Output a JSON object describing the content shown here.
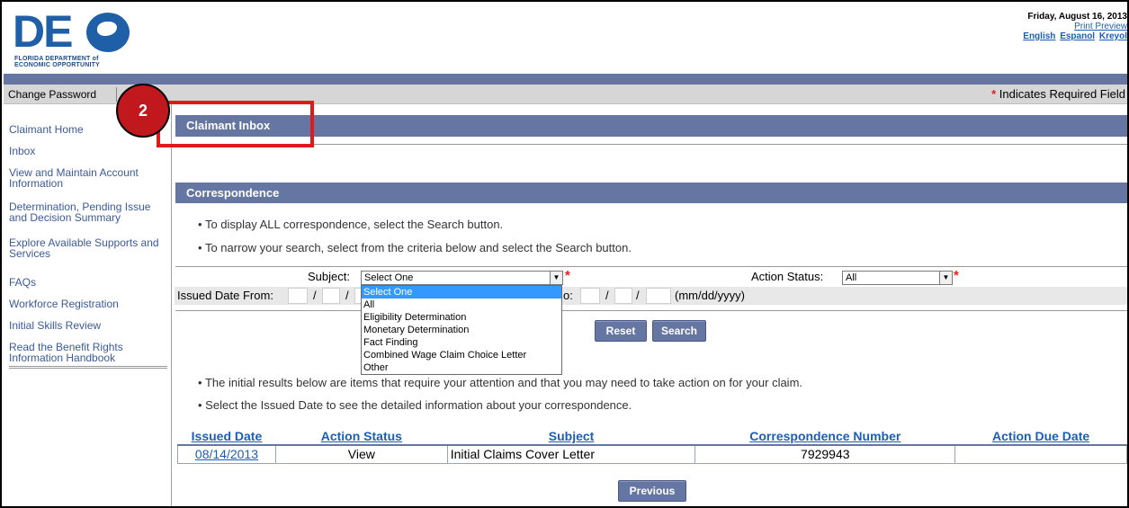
{
  "header": {
    "logo_letters": "DE",
    "logo_sub_line1": "FLORIDA DEPARTMENT of",
    "logo_sub_line2": "ECONOMIC OPPORTUNITY",
    "date": "Friday, August 16, 2013",
    "print_preview": "Print Preview",
    "languages": [
      "English",
      "Espanol",
      "Kreyol"
    ]
  },
  "toolbar": {
    "change_password": "Change Password",
    "required_star": "*",
    "required_note": "Indicates Required Field"
  },
  "sidebar": {
    "items": [
      "Claimant Home",
      "Inbox",
      "View and Maintain Account Information",
      "Determination, Pending Issue and Decision Summary",
      "Explore Available Supports and Services",
      "FAQs",
      "Workforce Registration",
      "Initial Skills Review",
      "Read the Benefit Rights Information Handbook"
    ]
  },
  "main": {
    "inbox_title": "Claimant Inbox",
    "correspondence_title": "Correspondence",
    "bullets_top": [
      "To display ALL correspondence, select the Search button.",
      "To narrow your search, select from the criteria below and select the Search button."
    ],
    "bullets_bottom": [
      "The initial results below are items that require your attention and that you may need to take action on for your claim.",
      "Select the Issued Date to see the detailed information about your correspondence."
    ]
  },
  "search": {
    "subject_label": "Subject:",
    "subject_value": "Select One",
    "subject_options": [
      "Select One",
      "All",
      "Eligibility Determination",
      "Monetary Determination",
      "Fact Finding",
      "Combined Wage Claim Choice Letter",
      "Other"
    ],
    "action_status_label": "Action Status:",
    "action_status_value": "All",
    "issued_from_label": "Issued Date From:",
    "to_label": "o:",
    "date_format": "(mm/dd/yyyy)",
    "reset_label": "Reset",
    "search_label": "Search",
    "star": "*"
  },
  "table": {
    "headers": [
      "Issued Date",
      "Action Status",
      "Subject",
      "Correspondence Number",
      "Action Due Date"
    ],
    "rows": [
      [
        "08/14/2013",
        "View",
        "Initial Claims Cover Letter",
        "7929943",
        ""
      ]
    ]
  },
  "pager": {
    "previous_label": "Previous"
  },
  "callout": {
    "number": "2"
  },
  "colors": {
    "section_header": "#6576a2",
    "link": "#1a5fb4",
    "callout_red": "#e01a1a"
  }
}
